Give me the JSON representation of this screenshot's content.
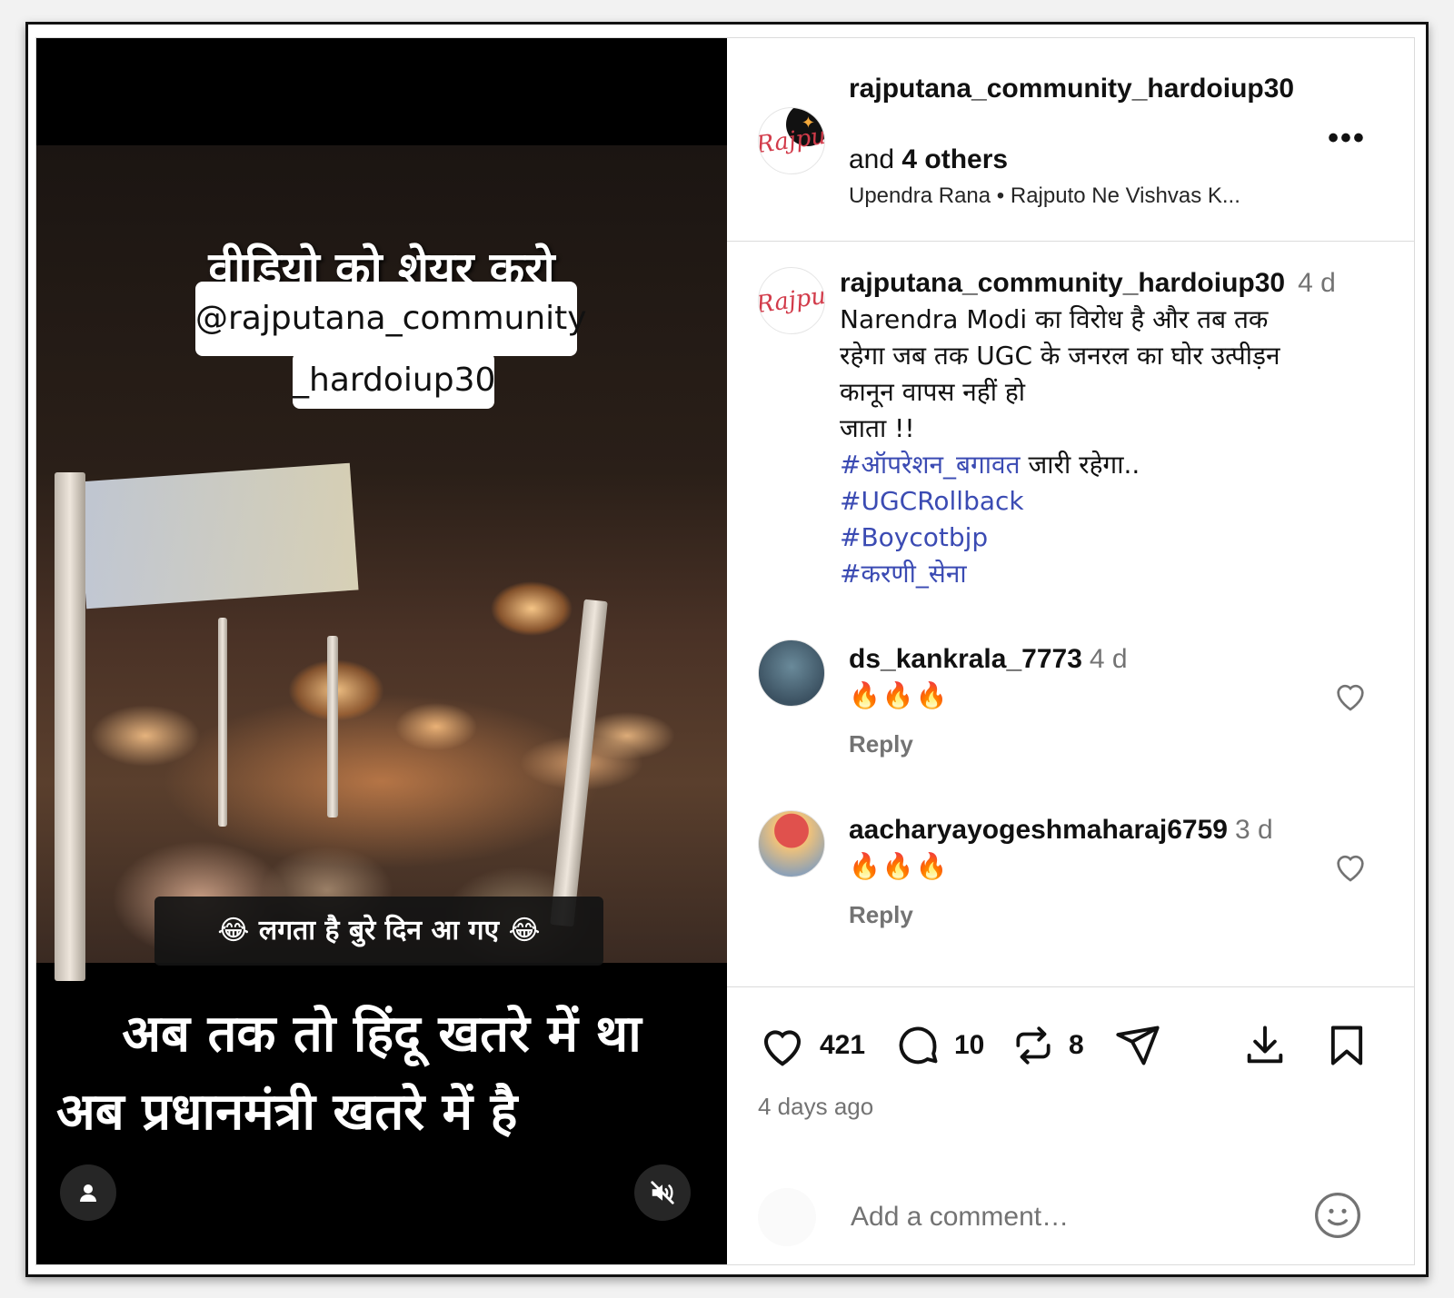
{
  "video": {
    "share_title": "वीडियो को शेयर करो",
    "handle_line1": "@rajputana_community",
    "handle_line2": "_hardoiup30",
    "caption_strip": "😂 लगता है बुरे दिन आ गए 😂",
    "bottom_line1": "अब तक तो हिंदू खतरे में था",
    "bottom_line2": "अब प्रधानमंत्री खतरे में है"
  },
  "header": {
    "username": "rajputana_community_hardoiup30",
    "and_text": "and ",
    "others": "4 others",
    "audio_artist": "Upendra Rana",
    "audio_sep": " • ",
    "audio_title": "Rajputo Ne Vishvas K...",
    "avatar_text": "Rajpu"
  },
  "caption": {
    "username": "rajputana_community_hardoiup30",
    "time": "4 d",
    "lines": [
      "Narendra Modi का विरोध है और तब तक",
      "रहेगा जब तक UGC के जनरल का घोर उत्पीड़न",
      "कानून वापस नहीं हो",
      "जाता !!"
    ],
    "tag1": "#ऑपरेशन_बगावत",
    "tag1_suffix": " जारी रहेगा..",
    "tag2": "#UGCRollback",
    "tag3": "#Boycotbjp",
    "tag4": "#करणी_सेना"
  },
  "comments": [
    {
      "username": "ds_kankrala_7773",
      "time": "4 d",
      "text": "🔥🔥🔥",
      "reply": "Reply"
    },
    {
      "username": "aacharyayogeshmaharaj6759",
      "time": "3 d",
      "text": "🔥🔥🔥",
      "reply": "Reply"
    }
  ],
  "actions": {
    "likes": "421",
    "comments": "10",
    "reposts": "8",
    "timestamp": "4 days ago"
  },
  "add_comment": {
    "placeholder": "Add a comment…"
  },
  "icons": [
    "user-icon",
    "muted-speaker-icon",
    "more-icon",
    "heart-icon",
    "comment-icon",
    "repost-icon",
    "share-icon",
    "download-icon",
    "bookmark-icon",
    "emoji-icon"
  ],
  "colors": {
    "hashtag": "#3b4bb3",
    "muted_text": "#737373",
    "border": "#dbdbdb"
  }
}
